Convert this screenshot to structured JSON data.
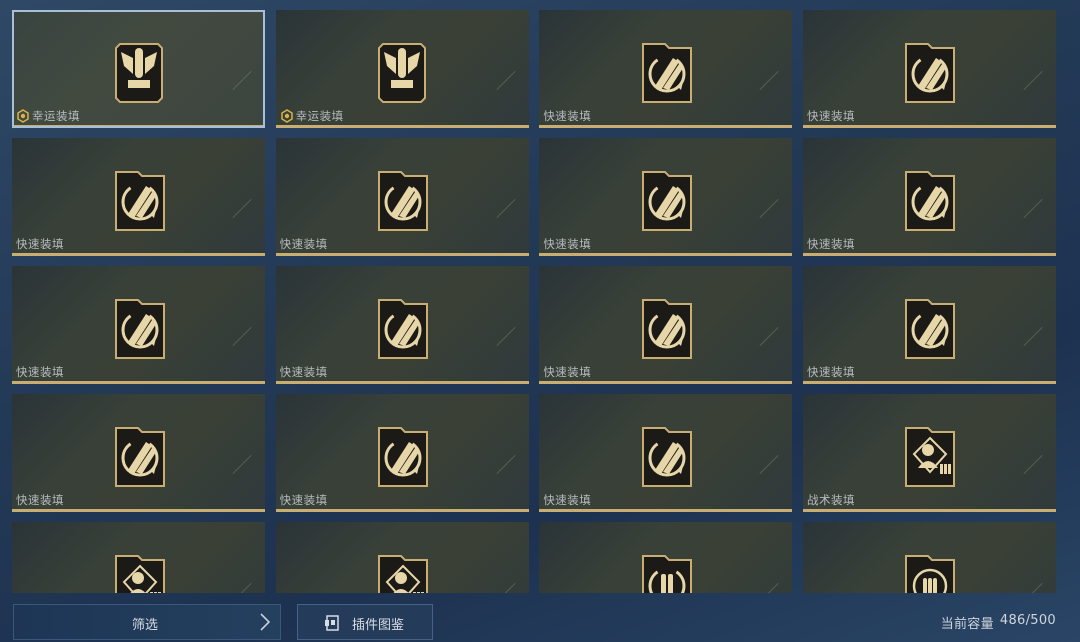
{
  "grid": {
    "cards": [
      {
        "label": "幸运装填",
        "icon": "wings-bullet-icon",
        "lucky": true,
        "selected": true
      },
      {
        "label": "幸运装填",
        "icon": "wings-bullet-icon",
        "lucky": true,
        "selected": false
      },
      {
        "label": "快速装填",
        "icon": "rapid-reload-icon",
        "lucky": false,
        "selected": false
      },
      {
        "label": "快速装填",
        "icon": "rapid-reload-icon",
        "lucky": false,
        "selected": false
      },
      {
        "label": "快速装填",
        "icon": "rapid-reload-icon",
        "lucky": false,
        "selected": false
      },
      {
        "label": "快速装填",
        "icon": "rapid-reload-icon",
        "lucky": false,
        "selected": false
      },
      {
        "label": "快速装填",
        "icon": "rapid-reload-icon",
        "lucky": false,
        "selected": false
      },
      {
        "label": "快速装填",
        "icon": "rapid-reload-icon",
        "lucky": false,
        "selected": false
      },
      {
        "label": "快速装填",
        "icon": "rapid-reload-icon",
        "lucky": false,
        "selected": false
      },
      {
        "label": "快速装填",
        "icon": "rapid-reload-icon",
        "lucky": false,
        "selected": false
      },
      {
        "label": "快速装填",
        "icon": "rapid-reload-icon",
        "lucky": false,
        "selected": false
      },
      {
        "label": "快速装填",
        "icon": "rapid-reload-icon",
        "lucky": false,
        "selected": false
      },
      {
        "label": "快速装填",
        "icon": "rapid-reload-icon",
        "lucky": false,
        "selected": false
      },
      {
        "label": "快速装填",
        "icon": "rapid-reload-icon",
        "lucky": false,
        "selected": false
      },
      {
        "label": "快速装填",
        "icon": "rapid-reload-icon",
        "lucky": false,
        "selected": false
      },
      {
        "label": "战术装填",
        "icon": "tactical-reload-icon",
        "lucky": false,
        "selected": false
      },
      {
        "label": "",
        "icon": "tactical-reload-icon",
        "lucky": false,
        "selected": false
      },
      {
        "label": "",
        "icon": "tactical-reload-icon",
        "lucky": false,
        "selected": false
      },
      {
        "label": "",
        "icon": "ammo-cycle-icon",
        "lucky": false,
        "selected": false
      },
      {
        "label": "",
        "icon": "ammo-target-icon",
        "lucky": false,
        "selected": false
      }
    ]
  },
  "bottom_bar": {
    "filter_label": "筛选",
    "catalog_label": "插件图鉴",
    "capacity_label": "当前容量",
    "capacity_value": "486/500"
  },
  "colors": {
    "gold": "#c8ae72",
    "icon_bg": "#1c1a16",
    "selected_outline": "#a9bfd6"
  }
}
